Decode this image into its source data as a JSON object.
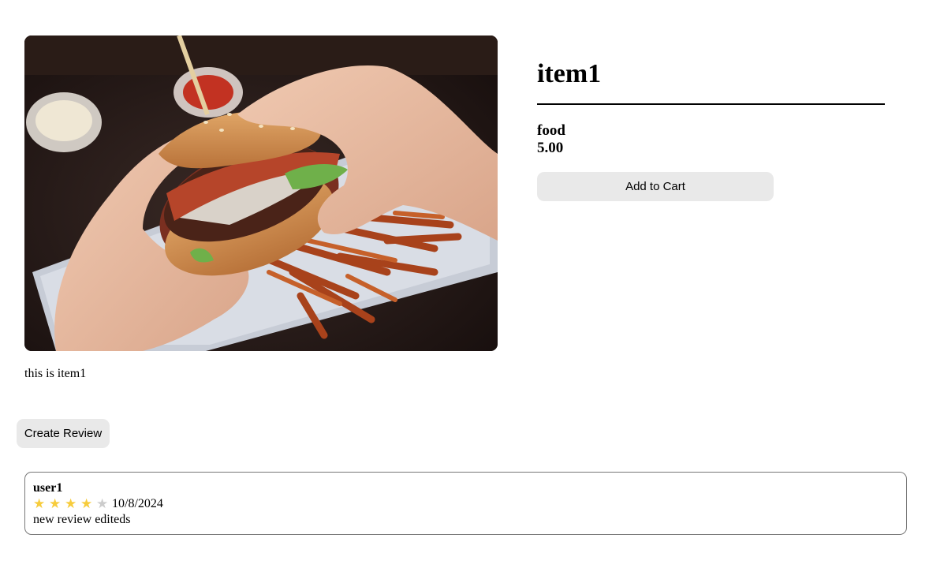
{
  "item": {
    "name": "item1",
    "category": "food",
    "price": "5.00",
    "description": "this is item1",
    "image_icon": "burger-photo"
  },
  "actions": {
    "add_to_cart_label": "Add to Cart",
    "create_review_label": "Create Review"
  },
  "reviews": [
    {
      "user": "user1",
      "rating": 4,
      "max_rating": 5,
      "date": "10/8/2024",
      "text": "new review editeds"
    }
  ],
  "colors": {
    "star_filled": "#f7cc3c",
    "star_empty": "#cccccc",
    "button_bg": "#e9e9e9"
  }
}
